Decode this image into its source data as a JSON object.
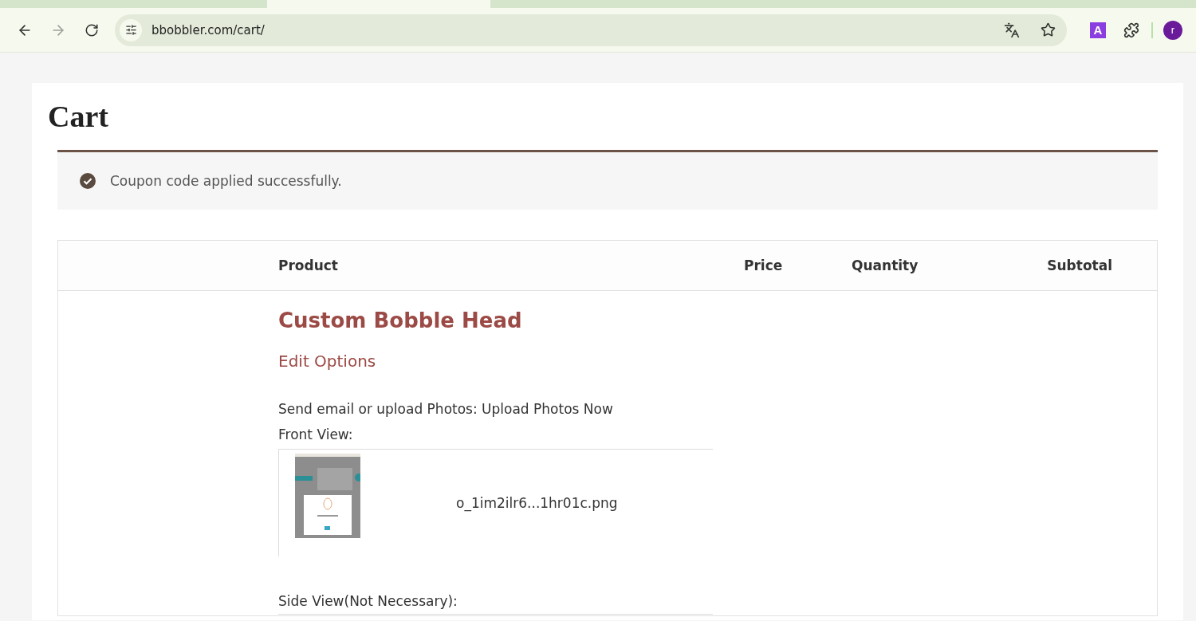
{
  "browser": {
    "url": "bbobbler.com/cart/",
    "extension_label": "A",
    "profile_initial": "r"
  },
  "page": {
    "title": "Cart"
  },
  "notice": {
    "kind": "success",
    "message": "Coupon code applied successfully."
  },
  "table": {
    "columns": [
      "Product",
      "Price",
      "Quantity",
      "Subtotal"
    ],
    "rows": [
      {
        "product": "Custom Bobble Head",
        "edit_link": "Edit Options",
        "meta": [
          "Send email or upload Photos: Upload Photos Now",
          "Front View:"
        ],
        "upload": {
          "filename": "o_1im2ilr6...1hr01c.png"
        },
        "side_label": "Side View(Not Necessary):"
      }
    ]
  }
}
